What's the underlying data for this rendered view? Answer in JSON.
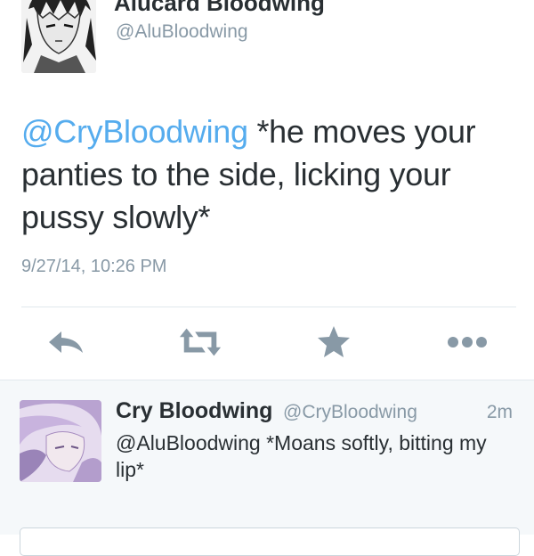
{
  "tweet": {
    "author_name": "Alucard Bloodwing",
    "author_handle": "@AluBloodwing",
    "mention": "@CryBloodwing",
    "text": " *he moves your panties to the side, licking your pussy slowly*",
    "timestamp": "9/27/14, 10:26 PM"
  },
  "actions": [
    {
      "icon": "reply-icon"
    },
    {
      "icon": "retweet-icon"
    },
    {
      "icon": "favorite-icon"
    },
    {
      "icon": "more-icon"
    }
  ],
  "reply": {
    "author_name": "Cry Bloodwing",
    "author_handle": "@CryBloodwing",
    "time": "2m",
    "text": "@AluBloodwing *Moans softly, bitting my lip*"
  },
  "colors": {
    "link": "#55acee",
    "icon": "#8899a6",
    "text": "#292f33",
    "muted": "#8899a6"
  }
}
